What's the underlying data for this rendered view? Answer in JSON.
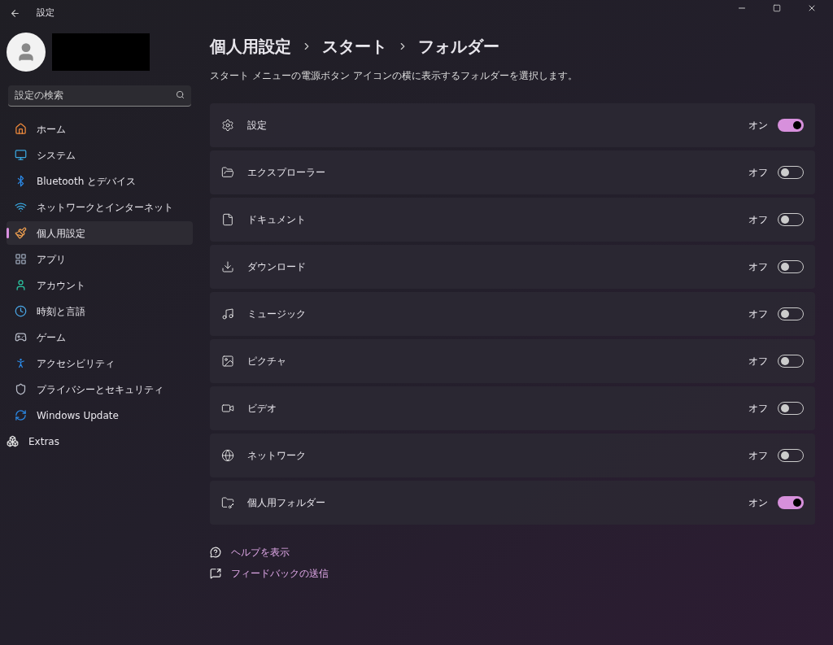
{
  "window": {
    "title": "設定"
  },
  "search": {
    "placeholder": "設定の検索"
  },
  "sidebar": {
    "items": [
      {
        "label": "ホーム",
        "selected": false
      },
      {
        "label": "システム",
        "selected": false
      },
      {
        "label": "Bluetooth とデバイス",
        "selected": false
      },
      {
        "label": "ネットワークとインターネット",
        "selected": false
      },
      {
        "label": "個人用設定",
        "selected": true
      },
      {
        "label": "アプリ",
        "selected": false
      },
      {
        "label": "アカウント",
        "selected": false
      },
      {
        "label": "時刻と言語",
        "selected": false
      },
      {
        "label": "ゲーム",
        "selected": false
      },
      {
        "label": "アクセシビリティ",
        "selected": false
      },
      {
        "label": "プライバシーとセキュリティ",
        "selected": false
      },
      {
        "label": "Windows Update",
        "selected": false
      },
      {
        "label": "Extras",
        "selected": false
      }
    ]
  },
  "breadcrumb": [
    "個人用設定",
    "スタート",
    "フォルダー"
  ],
  "description": "スタート メニューの電源ボタン アイコンの横に表示するフォルダーを選択します。",
  "folders": [
    {
      "label": "設定",
      "state": "オン",
      "on": true
    },
    {
      "label": "エクスプローラー",
      "state": "オフ",
      "on": false
    },
    {
      "label": "ドキュメント",
      "state": "オフ",
      "on": false
    },
    {
      "label": "ダウンロード",
      "state": "オフ",
      "on": false
    },
    {
      "label": "ミュージック",
      "state": "オフ",
      "on": false
    },
    {
      "label": "ピクチャ",
      "state": "オフ",
      "on": false
    },
    {
      "label": "ビデオ",
      "state": "オフ",
      "on": false
    },
    {
      "label": "ネットワーク",
      "state": "オフ",
      "on": false
    },
    {
      "label": "個人用フォルダー",
      "state": "オン",
      "on": true
    }
  ],
  "links": [
    "ヘルプを表示",
    "フィードバックの送信"
  ]
}
